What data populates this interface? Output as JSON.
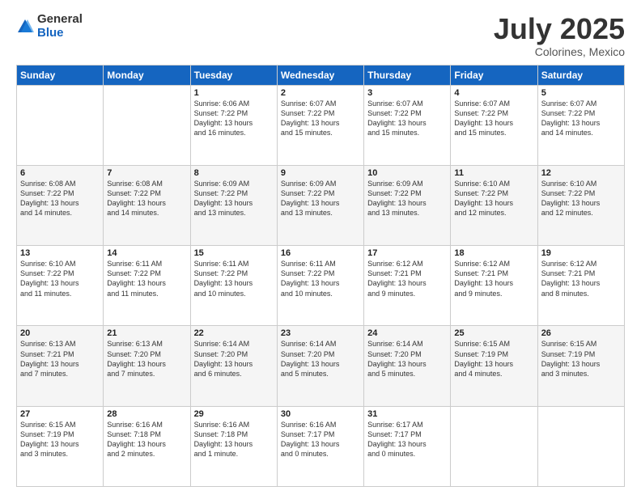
{
  "logo": {
    "general": "General",
    "blue": "Blue"
  },
  "title": "July 2025",
  "subtitle": "Colorines, Mexico",
  "weekdays": [
    "Sunday",
    "Monday",
    "Tuesday",
    "Wednesday",
    "Thursday",
    "Friday",
    "Saturday"
  ],
  "weeks": [
    [
      {
        "day": "",
        "info": ""
      },
      {
        "day": "",
        "info": ""
      },
      {
        "day": "1",
        "info": "Sunrise: 6:06 AM\nSunset: 7:22 PM\nDaylight: 13 hours\nand 16 minutes."
      },
      {
        "day": "2",
        "info": "Sunrise: 6:07 AM\nSunset: 7:22 PM\nDaylight: 13 hours\nand 15 minutes."
      },
      {
        "day": "3",
        "info": "Sunrise: 6:07 AM\nSunset: 7:22 PM\nDaylight: 13 hours\nand 15 minutes."
      },
      {
        "day": "4",
        "info": "Sunrise: 6:07 AM\nSunset: 7:22 PM\nDaylight: 13 hours\nand 15 minutes."
      },
      {
        "day": "5",
        "info": "Sunrise: 6:07 AM\nSunset: 7:22 PM\nDaylight: 13 hours\nand 14 minutes."
      }
    ],
    [
      {
        "day": "6",
        "info": "Sunrise: 6:08 AM\nSunset: 7:22 PM\nDaylight: 13 hours\nand 14 minutes."
      },
      {
        "day": "7",
        "info": "Sunrise: 6:08 AM\nSunset: 7:22 PM\nDaylight: 13 hours\nand 14 minutes."
      },
      {
        "day": "8",
        "info": "Sunrise: 6:09 AM\nSunset: 7:22 PM\nDaylight: 13 hours\nand 13 minutes."
      },
      {
        "day": "9",
        "info": "Sunrise: 6:09 AM\nSunset: 7:22 PM\nDaylight: 13 hours\nand 13 minutes."
      },
      {
        "day": "10",
        "info": "Sunrise: 6:09 AM\nSunset: 7:22 PM\nDaylight: 13 hours\nand 13 minutes."
      },
      {
        "day": "11",
        "info": "Sunrise: 6:10 AM\nSunset: 7:22 PM\nDaylight: 13 hours\nand 12 minutes."
      },
      {
        "day": "12",
        "info": "Sunrise: 6:10 AM\nSunset: 7:22 PM\nDaylight: 13 hours\nand 12 minutes."
      }
    ],
    [
      {
        "day": "13",
        "info": "Sunrise: 6:10 AM\nSunset: 7:22 PM\nDaylight: 13 hours\nand 11 minutes."
      },
      {
        "day": "14",
        "info": "Sunrise: 6:11 AM\nSunset: 7:22 PM\nDaylight: 13 hours\nand 11 minutes."
      },
      {
        "day": "15",
        "info": "Sunrise: 6:11 AM\nSunset: 7:22 PM\nDaylight: 13 hours\nand 10 minutes."
      },
      {
        "day": "16",
        "info": "Sunrise: 6:11 AM\nSunset: 7:22 PM\nDaylight: 13 hours\nand 10 minutes."
      },
      {
        "day": "17",
        "info": "Sunrise: 6:12 AM\nSunset: 7:21 PM\nDaylight: 13 hours\nand 9 minutes."
      },
      {
        "day": "18",
        "info": "Sunrise: 6:12 AM\nSunset: 7:21 PM\nDaylight: 13 hours\nand 9 minutes."
      },
      {
        "day": "19",
        "info": "Sunrise: 6:12 AM\nSunset: 7:21 PM\nDaylight: 13 hours\nand 8 minutes."
      }
    ],
    [
      {
        "day": "20",
        "info": "Sunrise: 6:13 AM\nSunset: 7:21 PM\nDaylight: 13 hours\nand 7 minutes."
      },
      {
        "day": "21",
        "info": "Sunrise: 6:13 AM\nSunset: 7:20 PM\nDaylight: 13 hours\nand 7 minutes."
      },
      {
        "day": "22",
        "info": "Sunrise: 6:14 AM\nSunset: 7:20 PM\nDaylight: 13 hours\nand 6 minutes."
      },
      {
        "day": "23",
        "info": "Sunrise: 6:14 AM\nSunset: 7:20 PM\nDaylight: 13 hours\nand 5 minutes."
      },
      {
        "day": "24",
        "info": "Sunrise: 6:14 AM\nSunset: 7:20 PM\nDaylight: 13 hours\nand 5 minutes."
      },
      {
        "day": "25",
        "info": "Sunrise: 6:15 AM\nSunset: 7:19 PM\nDaylight: 13 hours\nand 4 minutes."
      },
      {
        "day": "26",
        "info": "Sunrise: 6:15 AM\nSunset: 7:19 PM\nDaylight: 13 hours\nand 3 minutes."
      }
    ],
    [
      {
        "day": "27",
        "info": "Sunrise: 6:15 AM\nSunset: 7:19 PM\nDaylight: 13 hours\nand 3 minutes."
      },
      {
        "day": "28",
        "info": "Sunrise: 6:16 AM\nSunset: 7:18 PM\nDaylight: 13 hours\nand 2 minutes."
      },
      {
        "day": "29",
        "info": "Sunrise: 6:16 AM\nSunset: 7:18 PM\nDaylight: 13 hours\nand 1 minute."
      },
      {
        "day": "30",
        "info": "Sunrise: 6:16 AM\nSunset: 7:17 PM\nDaylight: 13 hours\nand 0 minutes."
      },
      {
        "day": "31",
        "info": "Sunrise: 6:17 AM\nSunset: 7:17 PM\nDaylight: 13 hours\nand 0 minutes."
      },
      {
        "day": "",
        "info": ""
      },
      {
        "day": "",
        "info": ""
      }
    ]
  ]
}
